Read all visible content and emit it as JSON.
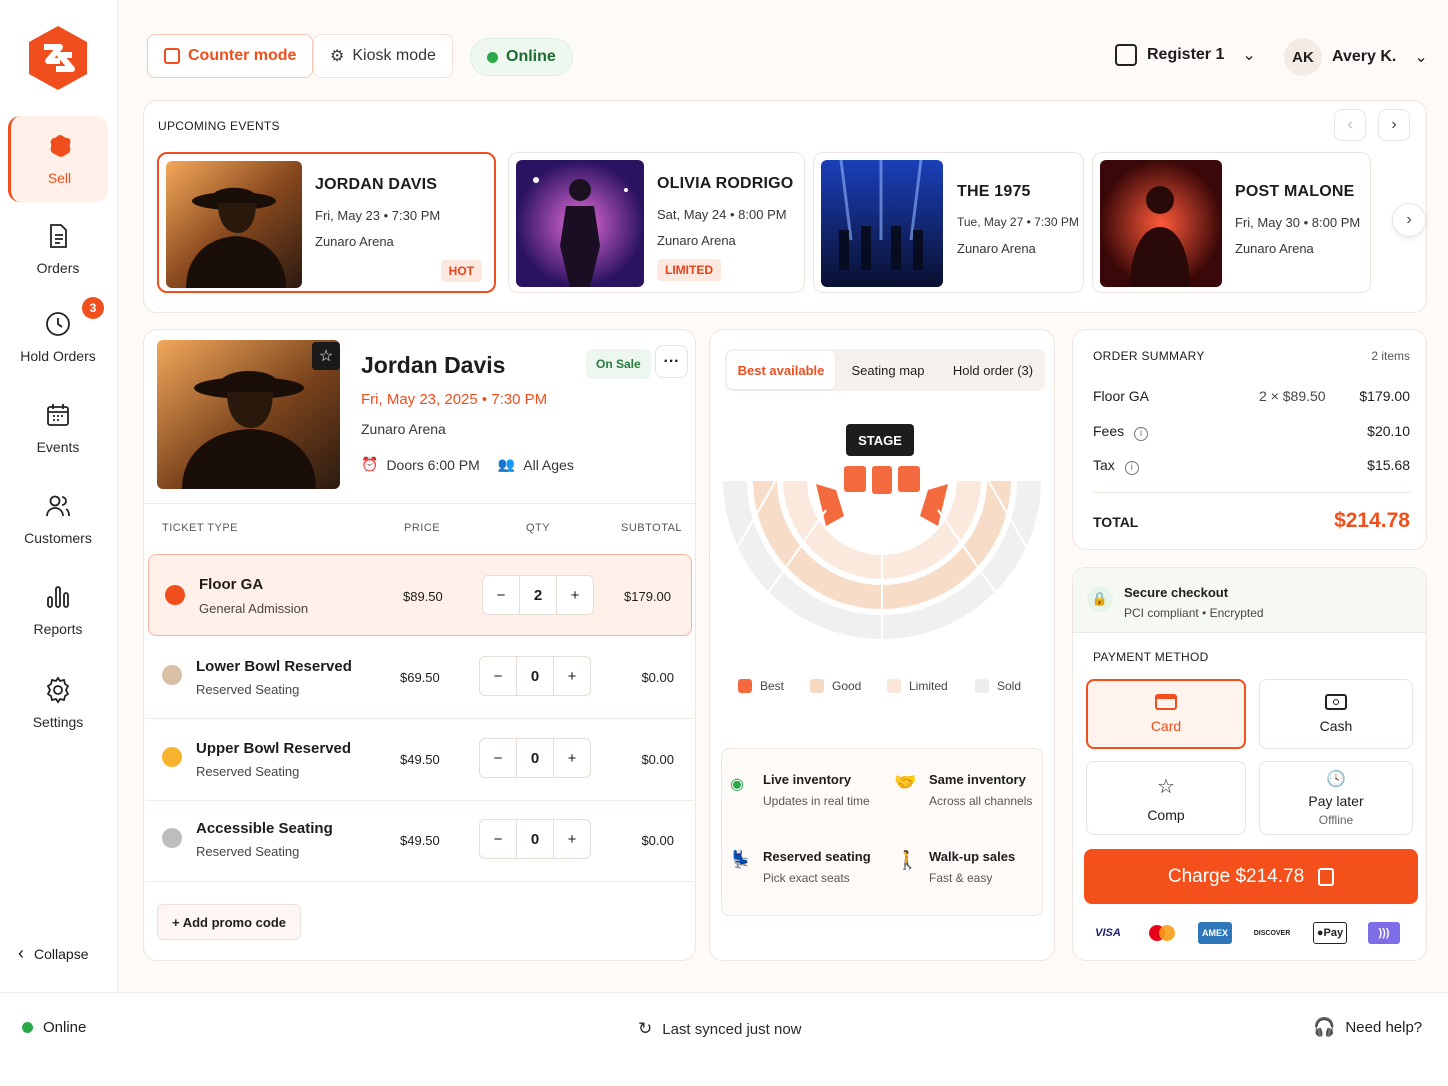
{
  "colors": {
    "accent": "#f04e1c",
    "online": "#2aa84a"
  },
  "sidebar": {
    "items": [
      {
        "label": "Sell",
        "icon": "ticket-icon",
        "active": true
      },
      {
        "label": "Orders",
        "icon": "document-icon"
      },
      {
        "label": "Hold Orders",
        "icon": "clock-icon",
        "badge": "3"
      },
      {
        "label": "Events",
        "icon": "calendar-icon"
      },
      {
        "label": "Customers",
        "icon": "users-icon"
      },
      {
        "label": "Reports",
        "icon": "bar-chart-icon"
      },
      {
        "label": "Settings",
        "icon": "gear-icon"
      }
    ],
    "collapse": "Collapse"
  },
  "header": {
    "counter_mode": "Counter mode",
    "kiosk_mode": "Kiosk mode",
    "status": "Online",
    "register": "Register 1",
    "avatar": "AK",
    "user": "Avery K."
  },
  "upcoming": {
    "title": "UPCOMING EVENTS",
    "events": [
      {
        "name": "JORDAN DAVIS",
        "date": "Fri, May 23",
        "time": "7:30 PM",
        "venue": "Zunaro Arena",
        "tag": "HOT"
      },
      {
        "name": "OLIVIA RODRIGO",
        "date": "Sat, May 24",
        "time": "8:00 PM",
        "venue": "Zunaro Arena",
        "tag": "LIMITED"
      },
      {
        "name": "THE 1975",
        "date": "Tue, May 27",
        "time": "7:30 PM",
        "venue": "Zunaro Arena"
      },
      {
        "name": "POST MALONE",
        "date": "Fri, May 30",
        "time": "8:00 PM",
        "venue": "Zunaro Arena"
      }
    ]
  },
  "event": {
    "name": "Jordan Davis",
    "status": "On Sale",
    "datetime": "Fri, May 23, 2025 • 7:30 PM",
    "venue": "Zunaro Arena",
    "doors": "Doors 6:00 PM",
    "ages": "All Ages"
  },
  "tickets": {
    "headers": {
      "type": "TICKET TYPE",
      "price": "PRICE",
      "qty": "QTY",
      "subtotal": "SUBTOTAL"
    },
    "rows": [
      {
        "name": "Floor GA",
        "sub": "General Admission",
        "price": "$89.50",
        "qty": "2",
        "subtotal": "$179.00",
        "color": "#f04e1c"
      },
      {
        "name": "Lower Bowl Reserved",
        "sub": "Reserved Seating",
        "price": "$69.50",
        "qty": "0",
        "subtotal": "$0.00",
        "color": "#d9bfa6"
      },
      {
        "name": "Upper Bowl Reserved",
        "sub": "Reserved Seating",
        "price": "$49.50",
        "qty": "0",
        "subtotal": "$0.00",
        "color": "#f7b32b"
      },
      {
        "name": "Accessible Seating",
        "sub": "Reserved Seating",
        "price": "$49.50",
        "qty": "0",
        "subtotal": "$0.00",
        "color": "#bdbdbd"
      }
    ],
    "minus": "−",
    "plus": "+",
    "promo": "+ Add promo code"
  },
  "seating": {
    "tabs": [
      "Best available",
      "Seating map",
      "Hold order (3)"
    ],
    "stage": "STAGE",
    "legend": [
      {
        "label": "Best",
        "color": "#f26a3d"
      },
      {
        "label": "Good",
        "color": "#f7d9c2"
      },
      {
        "label": "Limited",
        "color": "#fbe6da"
      },
      {
        "label": "Sold",
        "color": "#ececec"
      }
    ],
    "features": [
      {
        "title": "Live inventory",
        "sub": "Updates in real time",
        "icon": "live-icon"
      },
      {
        "title": "Same inventory",
        "sub": "Across all channels",
        "icon": "handshake-icon"
      },
      {
        "title": "Reserved seating",
        "sub": "Pick exact seats",
        "icon": "seat-icon"
      },
      {
        "title": "Walk-up sales",
        "sub": "Fast & easy",
        "icon": "walk-icon"
      }
    ]
  },
  "order": {
    "title": "ORDER SUMMARY",
    "count": "2 items",
    "floor_label": "Floor GA",
    "floor_qty": "2 × $89.50",
    "floor_total": "$179.00",
    "fees_label": "Fees",
    "fees": "$20.10",
    "tax_label": "Tax",
    "tax": "$15.68",
    "total_label": "TOTAL",
    "total": "$214.78"
  },
  "payment": {
    "secure_title": "Secure checkout",
    "secure_sub": "PCI compliant • Encrypted",
    "method_title": "PAYMENT METHOD",
    "card": "Card",
    "cash": "Cash",
    "comp": "Comp",
    "later": "Pay later",
    "later_sub": "Offline",
    "charge": "Charge $214.78",
    "brands": [
      "VISA",
      "",
      "AMEX",
      "DISCOVER",
      "Pay",
      ""
    ]
  },
  "footer": {
    "status": "Online",
    "sync": "Last synced just now",
    "help": "Need help?"
  }
}
